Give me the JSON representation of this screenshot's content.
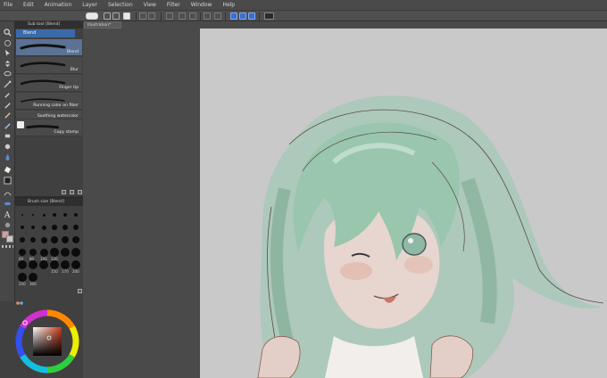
{
  "menu": [
    {
      "label": "File"
    },
    {
      "label": "Edit"
    },
    {
      "label": "Animation"
    },
    {
      "label": "Layer"
    },
    {
      "label": "Selection"
    },
    {
      "label": "View"
    },
    {
      "label": "Filter"
    },
    {
      "label": "Window"
    },
    {
      "label": "Help"
    }
  ],
  "command_bar": {
    "icons": [
      "toggle-view-icon",
      "new-icon",
      "open-icon",
      "save-icon",
      "undo-icon",
      "redo-icon",
      "clear-icon",
      "transform-icon",
      "snap-icon",
      "grid-icon",
      "ruler-icon",
      "help-icon"
    ]
  },
  "subtool_panel": {
    "header": "Sub tool [Blend]",
    "group_tab": "Blend",
    "brushes": [
      {
        "label": "Blend"
      },
      {
        "label": "Blur"
      },
      {
        "label": "Finger tip"
      },
      {
        "label": "Running color on fiber"
      },
      {
        "label": "Soothing watercolor"
      },
      {
        "label": "Copy stamp"
      }
    ]
  },
  "brush_size_panel": {
    "header": "Brush size [Blend]",
    "sizes": [
      "",
      "",
      "",
      "",
      "",
      "",
      "",
      "",
      "",
      "",
      "",
      "",
      "",
      "",
      "",
      "",
      "",
      "",
      "60",
      "80",
      "100",
      "120",
      "",
      "",
      "",
      "",
      "",
      "150",
      "170",
      "200",
      "250",
      "300"
    ]
  },
  "document": {
    "tab_label": "Illustration*"
  },
  "colors": {
    "accent": "#3b6aa8",
    "canvas_bg": "#c9c9c9",
    "main_color": "#c47a5a",
    "sub_color": "#ffffff",
    "hair_color": "#9cc7b0"
  },
  "tools": [
    "zoom-icon",
    "hand-icon",
    "operation-icon",
    "move-layer-icon",
    "lasso-icon",
    "auto-select-icon",
    "eyedropper-icon",
    "pen-icon",
    "pencil-icon",
    "brush-icon",
    "airbrush-icon",
    "decoration-icon",
    "eraser-icon",
    "blend-icon",
    "fill-icon",
    "gradient-icon",
    "figure-icon",
    "frame-icon",
    "balloon-icon",
    "text-icon",
    "correction-icon"
  ]
}
